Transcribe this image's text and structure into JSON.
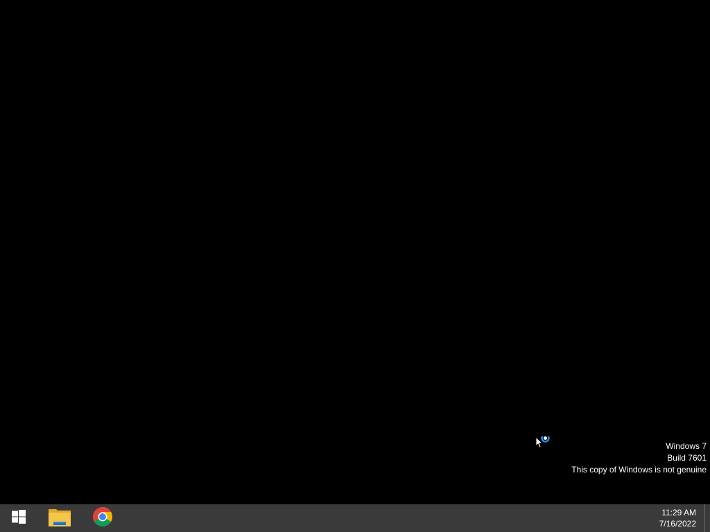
{
  "watermark": {
    "line1": "Windows 7",
    "line2": "Build 7601",
    "line3": "This copy of Windows is not genuine"
  },
  "taskbar": {
    "start_icon": "windows-logo-icon",
    "pinned": [
      {
        "icon": "file-explorer-icon"
      },
      {
        "icon": "chrome-icon"
      }
    ],
    "clock": {
      "time": "11:29 AM",
      "date": "7/16/2022"
    }
  },
  "cursor": {
    "icon": "busy-cursor-icon",
    "accent": "#1e90ff"
  },
  "colors": {
    "desktop_bg": "#000000",
    "taskbar_bg": "#3a3a3a",
    "text": "#ffffff"
  }
}
